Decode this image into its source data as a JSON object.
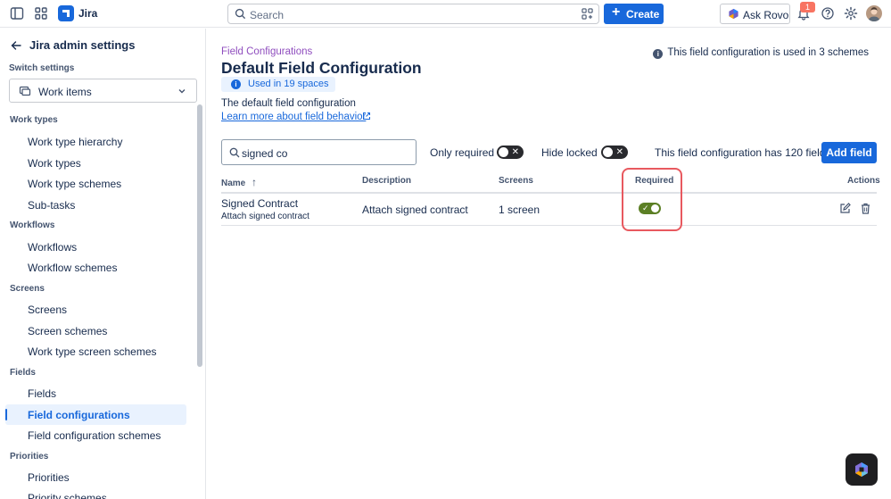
{
  "topbar": {
    "app_name": "Jira",
    "search_placeholder": "Search",
    "create_label": "Create",
    "ask_rovo_label": "Ask Rovo",
    "notification_count": "1"
  },
  "sidebar": {
    "title": "Jira admin settings",
    "switch_label": "Switch settings",
    "switch_value": "Work items",
    "sections": [
      {
        "label": "Work types",
        "items": [
          "Work type hierarchy",
          "Work types",
          "Work type schemes",
          "Sub-tasks"
        ]
      },
      {
        "label": "Workflows",
        "items": [
          "Workflows",
          "Workflow schemes"
        ]
      },
      {
        "label": "Screens",
        "items": [
          "Screens",
          "Screen schemes",
          "Work type screen schemes"
        ]
      },
      {
        "label": "Fields",
        "items": [
          "Fields",
          "Field configurations",
          "Field configuration schemes"
        ]
      },
      {
        "label": "Priorities",
        "items": [
          "Priorities",
          "Priority schemes"
        ]
      }
    ],
    "active_item": "Field configurations"
  },
  "main": {
    "breadcrumb": "Field Configurations",
    "title": "Default Field Configuration",
    "used_badge": "Used in 19 spaces",
    "description": "The default field configuration",
    "learn_more": "Learn more about field behavior",
    "scheme_info": "This field configuration is used in 3 schemes",
    "filter_value": "signed co",
    "only_required_label": "Only required",
    "only_required_on": false,
    "hide_locked_label": "Hide locked",
    "hide_locked_on": false,
    "field_count_text": "This field configuration has 120 fields",
    "add_field_label": "Add field",
    "table": {
      "headers": {
        "name": "Name",
        "description": "Description",
        "screens": "Screens",
        "required": "Required",
        "actions": "Actions"
      },
      "rows": [
        {
          "name": "Signed Contract",
          "sub": "Attach signed contract",
          "description": "Attach signed contract",
          "screens": "1 screen",
          "required": true
        }
      ]
    }
  },
  "colors": {
    "accent": "#1868db",
    "breadcrumb": "#8f4dbe",
    "toggle_on": "#5b7f24",
    "highlight": "#e8595f"
  }
}
